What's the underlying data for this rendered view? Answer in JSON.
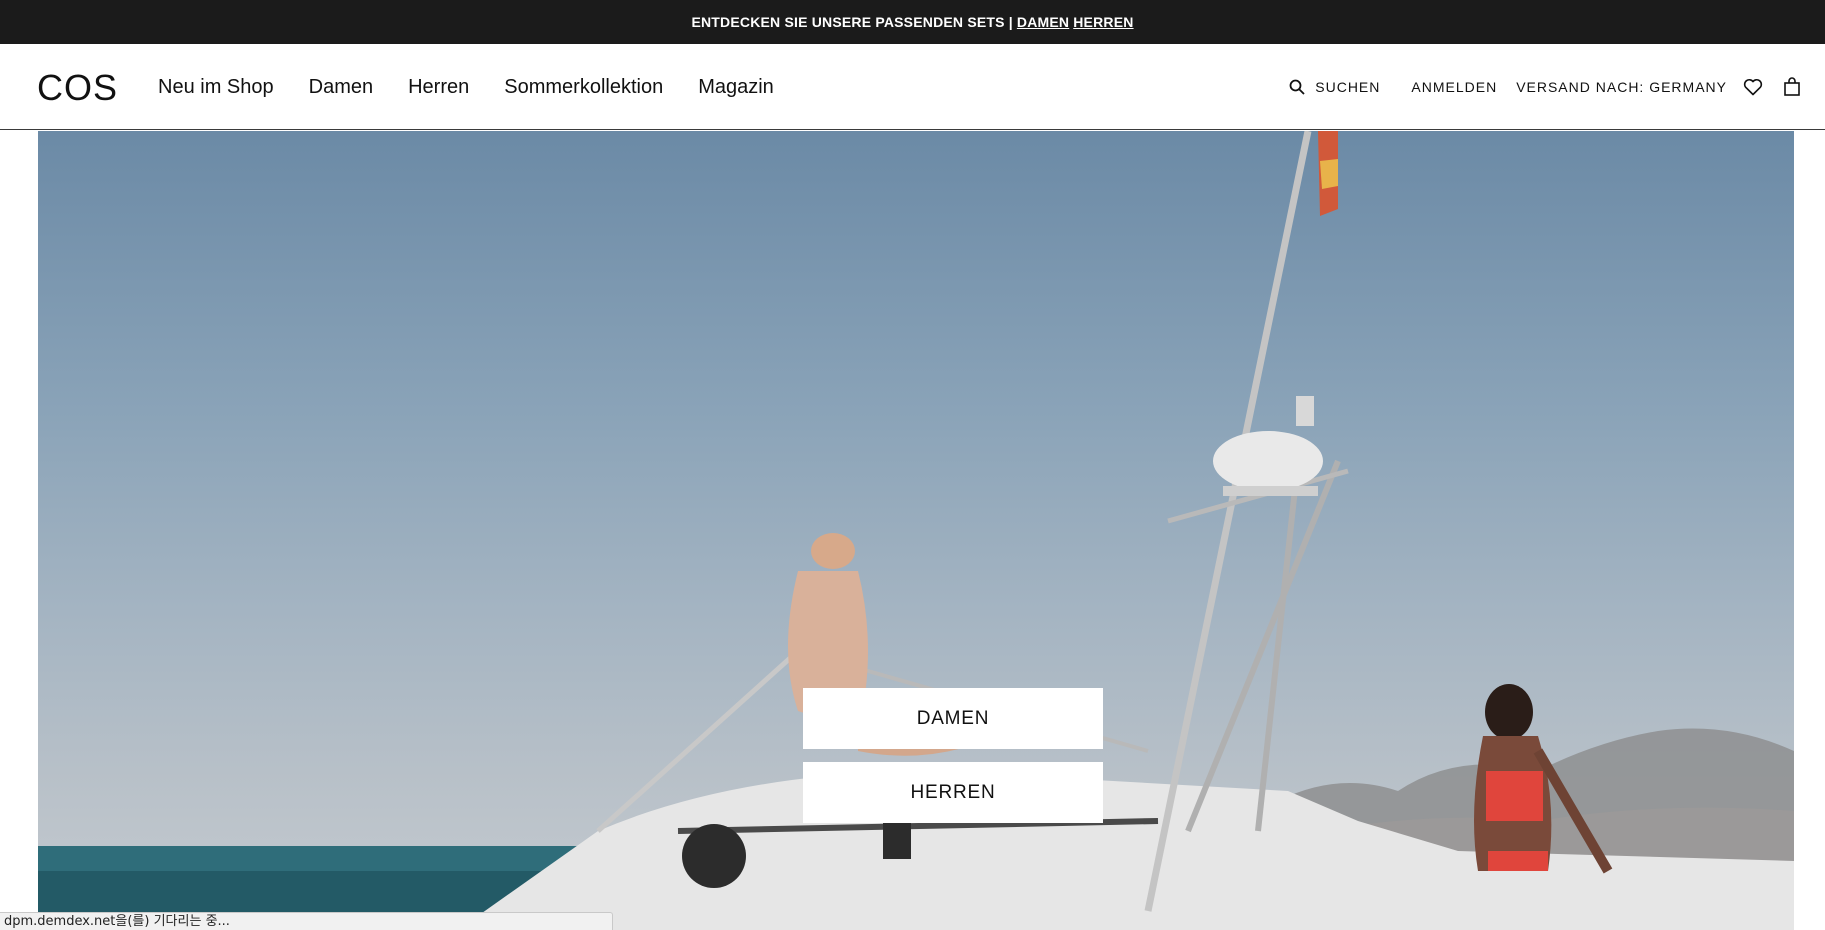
{
  "promo": {
    "text": "ENTDECKEN SIE UNSERE PASSENDEN SETS |",
    "link_damen": "DAMEN",
    "link_herren": "HERREN"
  },
  "header": {
    "logo": "COS",
    "nav": [
      {
        "label": "Neu im Shop"
      },
      {
        "label": "Damen"
      },
      {
        "label": "Herren"
      },
      {
        "label": "Sommerkollektion"
      },
      {
        "label": "Magazin"
      }
    ],
    "search_label": "SUCHEN",
    "login_label": "ANMELDEN",
    "shipping_label": "VERSAND NACH: GERMANY",
    "wishlist_icon": "heart-icon",
    "bag_icon": "shopping-bag-icon"
  },
  "hero": {
    "cta_damen": "DAMEN",
    "cta_herren": "HERREN"
  },
  "status_bar": {
    "text": "dpm.demdex.net을(를) 기다리는 중..."
  },
  "colors": {
    "promo_bg": "#1b1b1b",
    "text": "#111111",
    "button_bg": "#ffffff"
  }
}
